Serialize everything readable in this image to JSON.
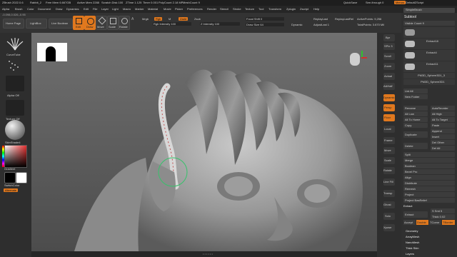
{
  "titlebar": {
    "app": "ZBrush 2022.0.6",
    "project": "Rabbit_2",
    "free_mem": "Free Mem 6.667GB",
    "active_mem": "Active Mem 2288",
    "scratch_disk": "Scratch Disk 100",
    "ztime": "ZTime 1.125",
    "timer": "Timer 0.001",
    "polycount": "PolyCount 2.18 MP",
    "meshcount": "MeshCount 9",
    "quicksave": "QuickSave",
    "seethrough": "See-through 0",
    "menus": "Menus",
    "default_script": "DefaultZScript"
  },
  "menubar": [
    "Alpha",
    "Brush",
    "Color",
    "Document",
    "Draw",
    "Dynamics",
    "Edit",
    "File",
    "Layer",
    "Light",
    "Macro",
    "Marker",
    "Material",
    "Movie",
    "Picker",
    "Preferences",
    "Render",
    "Stencil",
    "Stroke",
    "Texture",
    "Tool",
    "Transform",
    "Zplugin",
    "Zscript",
    "Help"
  ],
  "toolbar": {
    "coords": "-0.098,0.026,-0.95",
    "home_page": "Home Page",
    "lightbox": "LightBox",
    "live_boolean": "Live Boolean",
    "edit": "Edit",
    "draw": "Draw",
    "move": "Move",
    "scale": "Scale",
    "rotate": "Rotate",
    "a_label": "A",
    "mrgb": "Mrgb",
    "rgb": "Rgb",
    "m": "M",
    "zadd": "Zadd",
    "zsub": "Zsub",
    "rgb_intensity": "Rgb Intensity 100",
    "z_intensity": "Z Intensity 100",
    "focal_shift": "Focal Shift 0",
    "draw_size": "Draw Size 64",
    "dynamic": "Dynamic",
    "replay_last": "ReplayLast",
    "replay_last_rel": "ReplayLastRel",
    "adjust_last": "AdjustLast 1",
    "active_points": "ActivePoints: 9,256",
    "total_points": "TotalPoints: 3.670 Mil"
  },
  "left_shelf": {
    "brush_label": "CurveTube",
    "alpha_label": "Alpha Off",
    "texture_label": "Texture Off",
    "material_label": "SkinShade4",
    "gradient": "Gradient",
    "switch_color": "SwitchColor",
    "alternate": "Alternate",
    "stroke_icon": "dots-stroke-icon"
  },
  "palette": {
    "header": "SimpleBrush",
    "subtool": "Subtool",
    "visible_count": "Visible Count 9",
    "items": [
      "Extract18",
      "Extract4",
      "Extract11",
      "PM3D_Sphere3D1_3",
      "PM3D_Sphere3D1"
    ],
    "list_all": "List All",
    "new_folder": "New Folder",
    "rename": "Rename",
    "auto_reorder": "AutoReorder",
    "all_low": "All Low",
    "all_high": "All High",
    "all_to_home": "All To Home",
    "all_to_target": "All To Target",
    "copy": "Copy",
    "paste": "Paste",
    "duplicate": "Duplicate",
    "append": "Append",
    "insert": "Insert",
    "delete": "Delete",
    "del_other": "Del Other",
    "del_all": "Del All",
    "split": "Split",
    "merge": "Merge",
    "boolean": "Boolean",
    "bevel_pro": "Bevel Pro",
    "align": "Align",
    "distribute": "Distribute",
    "remesh": "Remesh",
    "project": "Project",
    "project_boolean": "Project BasRelief",
    "extract_header": "Extract",
    "extract_btn": "Extract",
    "s_smt": "S Smt 5",
    "thick": "Thick 0.02",
    "accept": "Accept",
    "double": "Double",
    "tcorne": "TCorne",
    "tborder": "TBorder",
    "geometry": "Geometry",
    "arraymesh": "ArrayMesh",
    "nanomesh": "NanoMesh",
    "thick_skin": "Thick Skin",
    "layers": "Layers"
  },
  "right_shelf": [
    "Bpr",
    "SPix 3",
    "Scroll",
    "Zoom",
    "Actual",
    "AAHalf",
    "Dynamic",
    "Persp",
    "Floor",
    "Local",
    "Frame",
    "Move",
    "Scale",
    "Rotate",
    "Line Fill",
    "Transp",
    "Ghost",
    "Solo",
    "Xpose"
  ],
  "colors": {
    "accent": "#e0781e",
    "panel": "#303030",
    "viewport_top": "#707070",
    "viewport_bottom": "#4c4c4c"
  }
}
